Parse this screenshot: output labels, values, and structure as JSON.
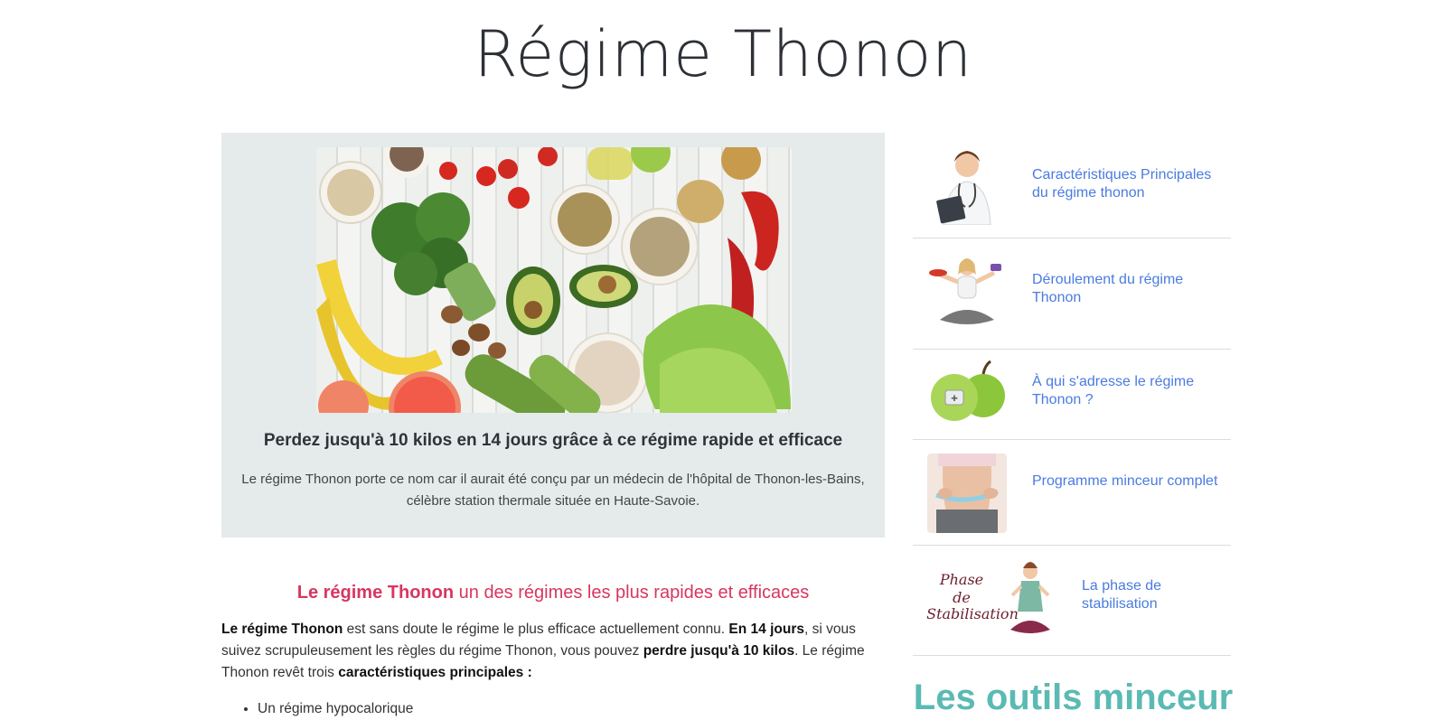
{
  "site": {
    "title": "Régime Thonon"
  },
  "feature": {
    "headline": "Perdez jusqu'à 10 kilos en 14 jours grâce à ce régime rapide et efficace",
    "description": "Le régime Thonon porte ce nom car il aurait été conçu par un médecin de l'hôpital de Thonon-les-Bains, célèbre station thermale située en Haute-Savoie."
  },
  "article": {
    "heading_bold": "Le régime Thonon",
    "heading_rest": " un des régimes les plus rapides et efficaces",
    "p1_b1": "Le régime Thonon",
    "p1_t1": " est sans doute le régime le plus efficace actuellement connu. ",
    "p1_b2": "En 14 jours",
    "p1_t2": ", si vous suivez scrupuleusement les règles du régime Thonon, vous pouvez ",
    "p1_b3": "perdre jusqu'à 10 kilos",
    "p1_t3": ". Le régime Thonon revêt trois ",
    "p1_b4": "caractéristiques principales :",
    "list": [
      "Un régime hypocalorique"
    ]
  },
  "sidebar": {
    "items": [
      {
        "label": "Caractéristiques Principales du régime thonon",
        "thumb": "doctor-thumbnail"
      },
      {
        "label": "Déroulement du régime Thonon",
        "thumb": "yoga-woman-thumbnail"
      },
      {
        "label": "À qui s'adresse le régime Thonon ?",
        "thumb": "apples-thumbnail"
      },
      {
        "label": "Programme minceur complet",
        "thumb": "waist-measure-thumbnail"
      },
      {
        "label": "La phase de stabilisation",
        "thumb": "stabilisation-illustration"
      }
    ],
    "stabilisation_image_text": [
      "Phase",
      "de",
      "Stabilisation"
    ],
    "tools_title": "Les outils minceur"
  },
  "colors": {
    "accent_link": "#4a7be0",
    "heading_pink": "#d8365f",
    "tools_teal": "#5bbab3",
    "feature_bg": "#e4ebea"
  }
}
